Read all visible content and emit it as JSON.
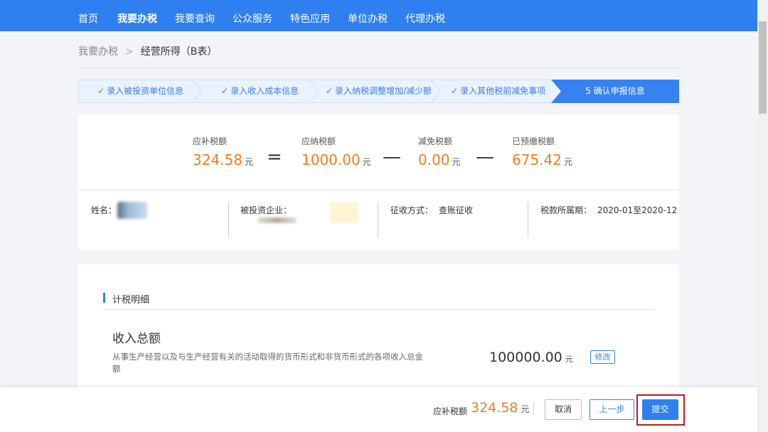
{
  "nav": {
    "items": [
      "首页",
      "我要办税",
      "我要查询",
      "公众服务",
      "特色应用",
      "单位办税",
      "代理办税"
    ],
    "active": "我要办税"
  },
  "breadcrumb": {
    "parent": "我要办税",
    "separator": ">",
    "current": "经营所得（B表）"
  },
  "steps": [
    {
      "label": "录入被投资单位信息",
      "done": true
    },
    {
      "label": "录入收入成本信息",
      "done": true
    },
    {
      "label": "录入纳税调整增加/减少额",
      "done": true
    },
    {
      "label": "录入其他税前减免事项",
      "done": true
    },
    {
      "label": "5 确认申报信息",
      "done": false,
      "active": true
    }
  ],
  "summary": {
    "payable": {
      "label": "应补税额",
      "value": "324.58",
      "unit": "元"
    },
    "tax_due": {
      "label": "应纳税额",
      "value": "1000.00",
      "unit": "元"
    },
    "relief": {
      "label": "减免税额",
      "value": "0.00",
      "unit": "元"
    },
    "prepaid": {
      "label": "已预缴税额",
      "value": "675.42",
      "unit": "元"
    },
    "ops": [
      "=",
      "—",
      "—"
    ]
  },
  "info": {
    "name_label": "姓名：",
    "company_label": "被投资企业：",
    "method_label": "征收方式：",
    "method_value": "查账征收",
    "period_label": "税款所属期：",
    "period_value": "2020-01至2020-12"
  },
  "detail": {
    "section_title": "计税明细",
    "income_title": "收入总额",
    "income_desc": "从事生产经营以及与生产经营有关的活动取得的货币形式和非货币形式的各项收入总金额",
    "income_value": "100000.00",
    "income_unit": "元",
    "modify_label": "修改"
  },
  "footer": {
    "label": "应补税额",
    "value": "324.58",
    "unit": "元",
    "cancel": "取消",
    "prev": "上一步",
    "submit": "提交"
  },
  "colors": {
    "primary": "#2f7ff0",
    "amount": "#f07c1e",
    "highlight_box": "#c21a1a"
  }
}
